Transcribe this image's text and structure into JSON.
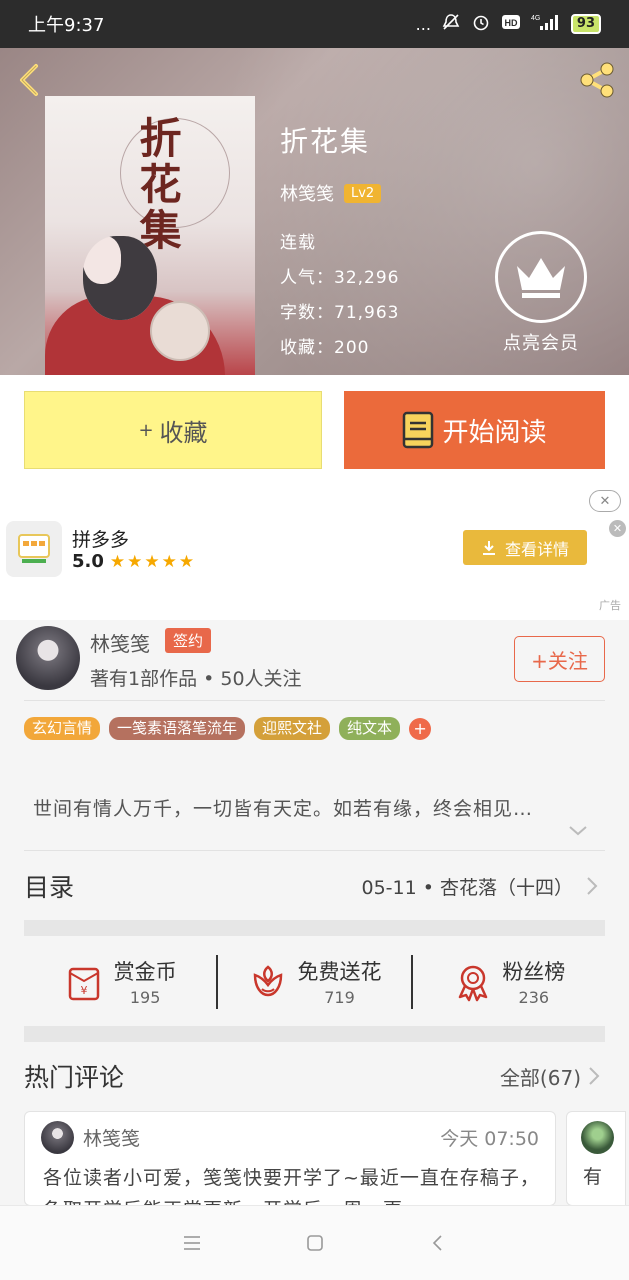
{
  "status_bar": {
    "time": "上午9:37",
    "network": "4G",
    "battery": "93",
    "dots": "..."
  },
  "book": {
    "title": "折花集",
    "author": "林笺笺",
    "level": "Lv2",
    "status": "连载",
    "popularity": "人气：32,296",
    "word_count": "字数：71,963",
    "favorites": "收藏：200",
    "cover_title": "折花集"
  },
  "vip": {
    "label": "点亮会员"
  },
  "actions": {
    "collect": "收藏",
    "collect_prefix": "+",
    "read": "开始阅读"
  },
  "ad": {
    "app_name": "拼多多",
    "rating": "5.0",
    "stars": "★★★★★",
    "button": "查看详情",
    "label": "广告",
    "close": "✕"
  },
  "author_card": {
    "name": "林笺笺",
    "badge": "签约",
    "desc": "著有1部作品 • 50人关注",
    "follow": "+关注"
  },
  "tags": [
    {
      "label": "玄幻言情",
      "color": "#f2a73a"
    },
    {
      "label": "一笺素语落笔流年",
      "color": "#b5715f"
    },
    {
      "label": "迎熙文社",
      "color": "#d4a03a"
    },
    {
      "label": "纯文本",
      "color": "#8fb05a"
    }
  ],
  "tag_add": "+",
  "intro": "世间有情人万千，一切皆有天定。如若有缘，终会相见…",
  "catalog": {
    "title": "目录",
    "latest": "05-11  •  杏花落（十四）"
  },
  "stats": [
    {
      "label": "赏金币",
      "value": "195"
    },
    {
      "label": "免费送花",
      "value": "719"
    },
    {
      "label": "粉丝榜",
      "value": "236"
    }
  ],
  "comments": {
    "title": "热门评论",
    "all": "全部(67)",
    "items": [
      {
        "user": "林笺笺",
        "time": "今天  07:50",
        "text": "各位读者小可爱，笺笺快要开学了~最近一直在存稿子，争取开学后能正常更新，开学后一周一更"
      },
      {
        "text": "有"
      }
    ]
  },
  "colors": {
    "accent": "#eb6a3b",
    "collect_bg": "#fff58a",
    "badge": "#e8684a",
    "lv_badge": "#f0b431",
    "ad_button": "#e9b93c"
  }
}
